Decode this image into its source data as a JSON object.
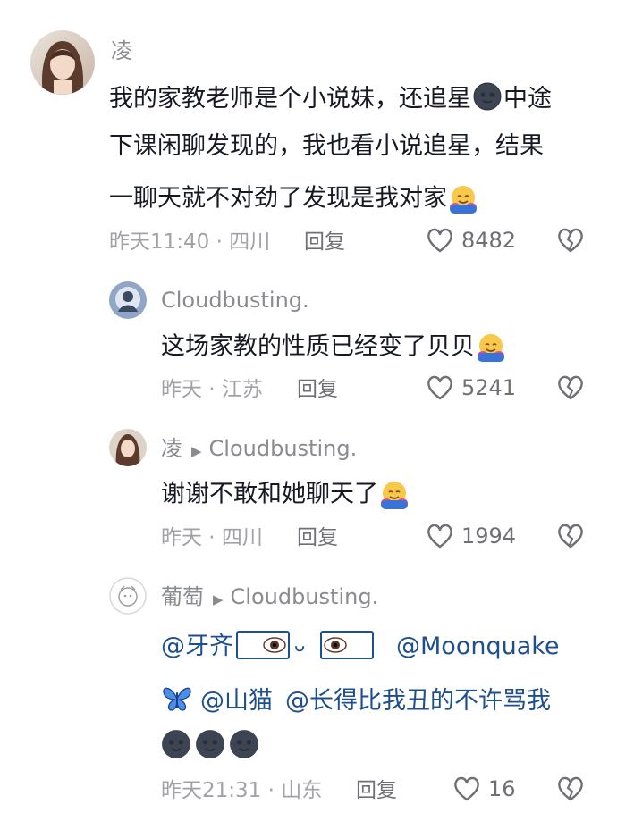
{
  "comments": [
    {
      "author": "凌",
      "lines": [
        "我的家教老师是个小说妹，还追星",
        "中途",
        "下课闲聊发现的，我也看小说追星，结果",
        "一聊天就不对劲了发现是我对家"
      ],
      "time": "昨天11:40 · 四川",
      "reply_label": "回复",
      "likes": "8482"
    },
    {
      "author": "Cloudbusting.",
      "text": "这场家教的性质已经变了贝贝",
      "time": "昨天 · 江苏",
      "reply_label": "回复",
      "likes": "5241"
    },
    {
      "author": "凌",
      "reply_to": "Cloudbusting.",
      "text": "谢谢不敢和她聊天了",
      "time": "昨天 · 四川",
      "reply_label": "回复",
      "likes": "1994"
    },
    {
      "author": "葡萄",
      "reply_to": "Cloudbusting.",
      "mention1": "@牙齐",
      "mention2": "@Moonquake",
      "mention3": "@山猫",
      "mention4": "@长得比我丑的不许骂我",
      "time": "昨天21:31 · 山东",
      "reply_label": "回复",
      "likes": "16"
    }
  ],
  "colors": {
    "text": "#161823",
    "meta": "#a1a2a7",
    "mention": "#1d4f8f"
  },
  "icons": [
    "heart-outline-icon",
    "broken-heart-icon",
    "new-moon-face-emoji",
    "hugging-face-emoji",
    "butterfly-emoji",
    "eye-emoji",
    "reply-arrow-icon"
  ]
}
